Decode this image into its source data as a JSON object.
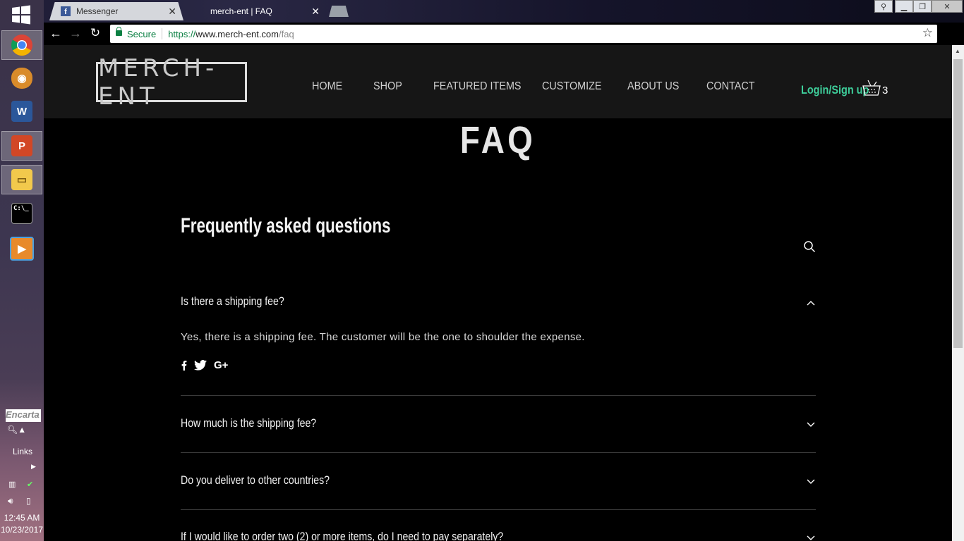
{
  "taskbar": {
    "apps": [
      "chrome-icon",
      "archive-icon",
      "word-icon",
      "powerpoint-icon",
      "file-explorer-icon",
      "command-prompt-icon",
      "media-player-icon"
    ],
    "encarta": "Encarta",
    "links_label": "Links",
    "clock_time": "12:45 AM",
    "clock_date": "10/23/2017"
  },
  "browser": {
    "tabs": [
      {
        "label": "Messenger",
        "active": false
      },
      {
        "label": "merch-ent | FAQ",
        "active": true
      }
    ],
    "secure_label": "Secure",
    "url_scheme": "https://",
    "url_host": "www.merch-ent.com",
    "url_path": "/faq"
  },
  "site": {
    "logo": "MERCH-ENT",
    "nav": [
      "HOME",
      "SHOP",
      "FEATURED ITEMS",
      "CUSTOMIZE",
      "ABOUT US",
      "CONTACT"
    ],
    "login": "Login/Sign up",
    "cart_count": "3",
    "accent_color": "#3ecf9b"
  },
  "faq": {
    "page_title": "FAQ",
    "heading": "Frequently asked questions",
    "questions": [
      {
        "q": "Is there a shipping fee?",
        "expanded": true,
        "answer": "Yes, there is a shipping fee. The customer will be the one to shoulder the expense."
      },
      {
        "q": "How much is the shipping fee?",
        "expanded": false
      },
      {
        "q": "Do you deliver to other countries?",
        "expanded": false
      },
      {
        "q": "If I would like to order two (2) or more items, do I need to pay separately?",
        "expanded": false
      }
    ],
    "share_icons": [
      "facebook-icon",
      "twitter-icon",
      "google-plus-icon"
    ]
  }
}
